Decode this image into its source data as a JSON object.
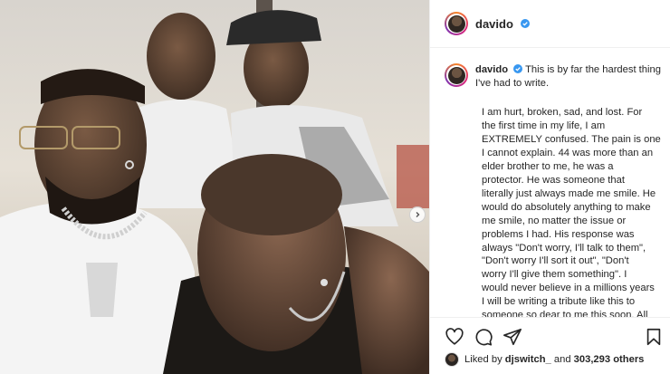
{
  "post": {
    "username": "davido",
    "verified": true,
    "caption_intro": "This is by far the hardest thing I've had to write.",
    "caption_body": "I am hurt, broken, sad, and lost. For\nthe first time in my life, I am\nEXTREMELY confused. The pain is one\nI cannot explain. 44 was more than an\nelder brother to me, he was a\nprotector. He was someone that\nliterally just always made me smile. He\nwould do absolutely anything to make\nme smile, no matter the issue or\nproblems I had. His response was\nalways \"Don't worry, I'll talk to them\",\n\"Don't worry I'll sort it out\", \"Don't\nworry I'll give them something\". I\nwould never believe in a millions years\nI will be writing a tribute like this to\nsomeone so dear to me this soon. All",
    "likes": {
      "prefix": "Liked by",
      "first_user": "djswitch_",
      "connector": "and",
      "count": "303,293 others"
    }
  },
  "icons": {
    "like": "heart-icon",
    "comment": "comment-icon",
    "share": "share-icon",
    "save": "bookmark-icon",
    "verified": "verified-badge-icon",
    "next": "chevron-right-icon"
  },
  "colors": {
    "verified": "#3897f0",
    "text": "#262626",
    "border": "#efefef"
  }
}
